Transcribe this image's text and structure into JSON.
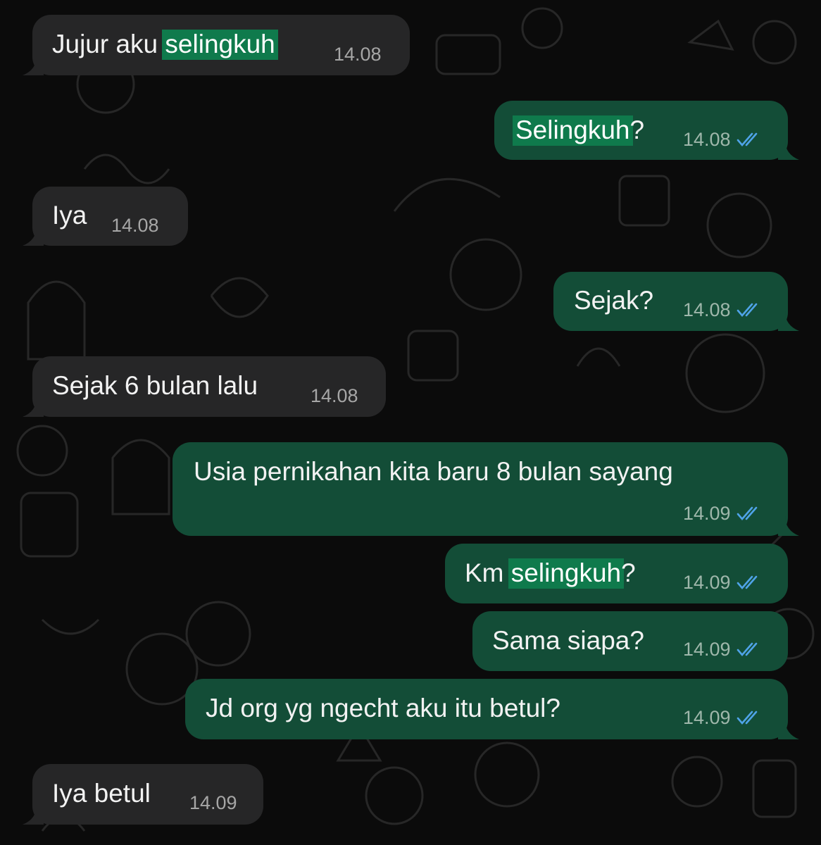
{
  "chat": {
    "colors": {
      "incoming_bubble": "#262627",
      "outgoing_bubble": "#134d37",
      "highlight": "#0f7a4c",
      "read_ticks": "#4fa3e8",
      "background": "#0b0b0b"
    },
    "messages": [
      {
        "direction": "incoming",
        "text_before": "Jujur aku ",
        "highlight": "selingkuh",
        "text_after": "",
        "time": "14.08"
      },
      {
        "direction": "outgoing",
        "text_before": "",
        "highlight": "Selingkuh",
        "text_after": "?",
        "time": "14.08",
        "status_icon": "double-check-read-icon"
      },
      {
        "direction": "incoming",
        "text": "Iya",
        "time": "14.08"
      },
      {
        "direction": "outgoing",
        "text": "Sejak?",
        "time": "14.08",
        "status_icon": "double-check-read-icon"
      },
      {
        "direction": "incoming",
        "text": "Sejak 6 bulan lalu",
        "time": "14.08"
      },
      {
        "direction": "outgoing",
        "text": "Usia pernikahan kita baru 8 bulan sayang",
        "time": "14.09",
        "status_icon": "double-check-read-icon"
      },
      {
        "direction": "outgoing",
        "text_before": "Km ",
        "highlight": "selingkuh",
        "text_after": "?",
        "time": "14.09",
        "status_icon": "double-check-read-icon"
      },
      {
        "direction": "outgoing",
        "text": "Sama siapa?",
        "time": "14.09",
        "status_icon": "double-check-read-icon"
      },
      {
        "direction": "outgoing",
        "text": "Jd org yg ngecht aku itu betul?",
        "time": "14.09",
        "status_icon": "double-check-read-icon"
      },
      {
        "direction": "incoming",
        "text": "Iya betul",
        "time": "14.09"
      }
    ]
  }
}
